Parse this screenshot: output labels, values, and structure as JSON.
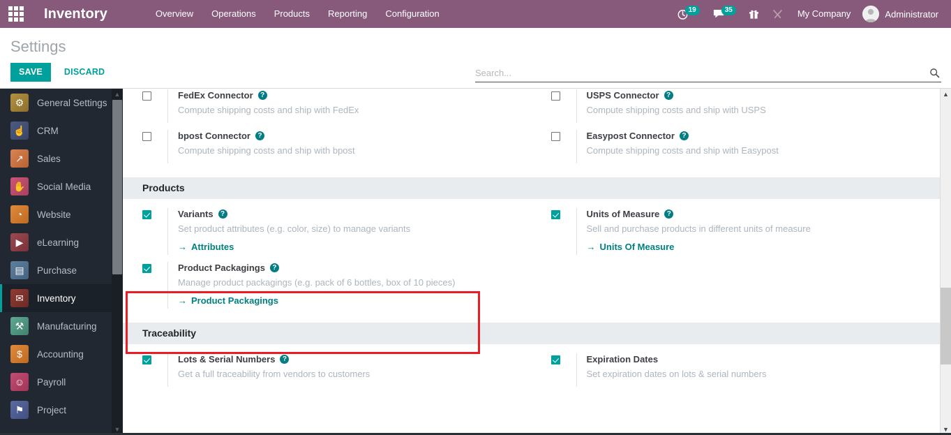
{
  "navbar": {
    "apps_menu_label": "apps-grid",
    "brand": "Inventory",
    "menu_items": [
      {
        "label": "Overview"
      },
      {
        "label": "Operations"
      },
      {
        "label": "Products"
      },
      {
        "label": "Reporting"
      },
      {
        "label": "Configuration"
      }
    ],
    "systray": {
      "activities_icon": "clock-icon",
      "activities_count": "19",
      "messages_icon": "speech-bubble-icon",
      "messages_count": "35",
      "gift_icon": "gift-icon",
      "debug_icon": "wrench-tools-icon"
    },
    "company": "My Company",
    "user": "Administrator",
    "accent_color": "#875A7B",
    "badge_color": "#00A09D"
  },
  "control_panel": {
    "breadcrumb": "Settings",
    "save_label": "SAVE",
    "discard_label": "DISCARD",
    "search": {
      "placeholder": "Search...",
      "value": "",
      "icon": "search-icon"
    }
  },
  "sidebar": {
    "items": [
      {
        "label": "General Settings",
        "icon": "gear-icon",
        "color1": "#b5923f",
        "color2": "#8c6f2c",
        "glyph": "⚙",
        "active": false
      },
      {
        "label": "CRM",
        "icon": "handshake-icon",
        "color1": "#4d5b80",
        "color2": "#39456a",
        "glyph": "☝",
        "active": false
      },
      {
        "label": "Sales",
        "icon": "chart-line-icon",
        "color1": "#d98352",
        "color2": "#b96233",
        "glyph": "↗",
        "active": false
      },
      {
        "label": "Social Media",
        "icon": "thumbs-up-icon",
        "color1": "#cc5577",
        "color2": "#a8405e",
        "glyph": "✋",
        "active": false
      },
      {
        "label": "Website",
        "icon": "globe-icon",
        "color1": "#e08a3c",
        "color2": "#c06a22",
        "glyph": "◔",
        "active": false
      },
      {
        "label": "eLearning",
        "icon": "video-icon",
        "color1": "#9a4a52",
        "color2": "#7a3238",
        "glyph": "▶",
        "active": false
      },
      {
        "label": "Purchase",
        "icon": "card-icon",
        "color1": "#5d7f9e",
        "color2": "#456380",
        "glyph": "▤",
        "active": false
      },
      {
        "label": "Inventory",
        "icon": "box-icon",
        "color1": "#8e3b33",
        "color2": "#6e2a24",
        "glyph": "✉",
        "active": true
      },
      {
        "label": "Manufacturing",
        "icon": "wrench-icon",
        "color1": "#5fa893",
        "color2": "#41826f",
        "glyph": "⚒",
        "active": false
      },
      {
        "label": "Accounting",
        "icon": "invoice-icon",
        "color1": "#e08a3c",
        "color2": "#c06a22",
        "glyph": "$",
        "active": false
      },
      {
        "label": "Payroll",
        "icon": "person-id-icon",
        "color1": "#c34d72",
        "color2": "#a13559",
        "glyph": "☺",
        "active": false
      },
      {
        "label": "Project",
        "icon": "pin-flag-icon",
        "color1": "#5a6ba0",
        "color2": "#414f80",
        "glyph": "⚑",
        "active": false
      }
    ],
    "scroll_up_icon": "chevron-up-icon",
    "scroll_down_icon": "chevron-down-icon"
  },
  "main": {
    "blocks": [
      {
        "id": "shipping-partial",
        "title": null,
        "partial_top": true,
        "settings": [
          {
            "name": "fedex-connector",
            "checked": false,
            "title": "FedEx Connector",
            "help": "?",
            "desc": "Compute shipping costs and ship with FedEx",
            "link": null
          },
          {
            "name": "usps-connector",
            "checked": false,
            "title": "USPS Connector",
            "help": "?",
            "desc": "Compute shipping costs and ship with USPS",
            "link": null
          },
          {
            "name": "bpost-connector",
            "checked": false,
            "title": "bpost Connector",
            "help": "?",
            "desc": "Compute shipping costs and ship with bpost",
            "link": null
          },
          {
            "name": "easypost-connector",
            "checked": false,
            "title": "Easypost Connector",
            "help": "?",
            "desc": "Compute shipping costs and ship with Easypost",
            "link": null
          }
        ]
      },
      {
        "id": "products",
        "title": "Products",
        "partial_top": false,
        "settings": [
          {
            "name": "variants",
            "checked": true,
            "title": "Variants",
            "help": "?",
            "desc": "Set product attributes (e.g. color, size) to manage variants",
            "link": "Attributes"
          },
          {
            "name": "units-of-measure",
            "checked": true,
            "title": "Units of Measure",
            "help": "?",
            "desc": "Sell and purchase products in different units of measure",
            "link": "Units Of Measure"
          },
          {
            "name": "product-packagings",
            "checked": true,
            "title": "Product Packagings",
            "help": "?",
            "desc": "Manage product packagings (e.g. pack of 6 bottles, box of 10 pieces)",
            "link": "Product Packagings",
            "highlighted": true
          }
        ]
      },
      {
        "id": "traceability",
        "title": "Traceability",
        "partial_top": false,
        "settings": [
          {
            "name": "lots-serial-numbers",
            "checked": true,
            "title": "Lots & Serial Numbers",
            "help": "?",
            "desc": "Get a full traceability from vendors to customers",
            "link": null
          },
          {
            "name": "expiration-dates",
            "checked": true,
            "title": "Expiration Dates",
            "help": null,
            "desc": "Set expiration dates on lots & serial numbers",
            "link": null
          }
        ]
      }
    ],
    "highlight_color": "#ec1c24",
    "link_arrow": "→"
  },
  "scrollbar": {
    "up_icon": "chevron-up-icon",
    "down_icon": "chevron-down-icon"
  }
}
